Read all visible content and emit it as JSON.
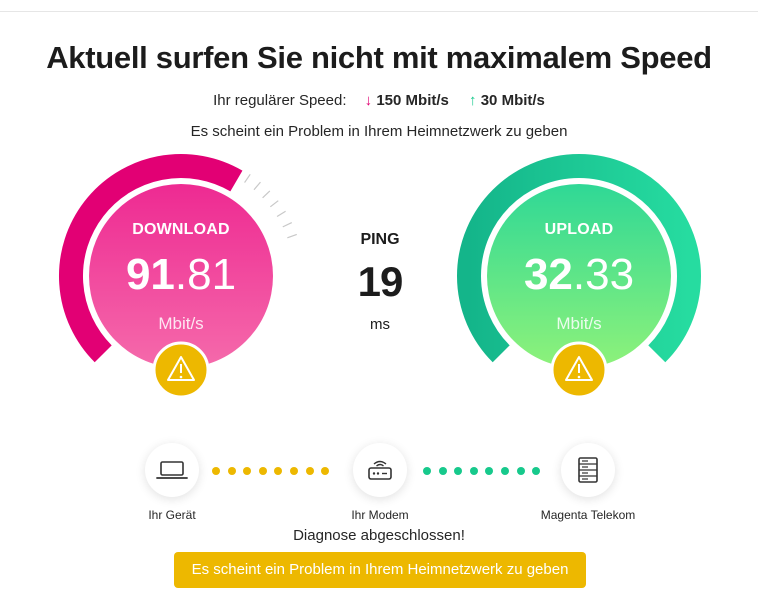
{
  "header": {
    "title": "Aktuell surfen Sie nicht mit maximalem Speed",
    "regular_speed_label": "Ihr regulärer Speed:",
    "download_speed": "150 Mbit/s",
    "upload_speed": "30 Mbit/s",
    "down_arrow": "↓",
    "up_arrow": "↑",
    "subtitle": "Es scheint ein Problem in Ihrem Heimnetzwerk zu geben"
  },
  "download": {
    "label": "DOWNLOAD",
    "value_int": "91",
    "value_dec": ".81",
    "unit": "Mbit/s",
    "color": "#e20074",
    "fraction_of_regular": 0.612,
    "warning_icon": "warning-icon"
  },
  "upload": {
    "label": "UPLOAD",
    "value_int": "32",
    "value_dec": ".33",
    "unit": "Mbit/s",
    "color": "#17c98c",
    "fraction_of_regular": 1.0,
    "warning_icon": "warning-icon"
  },
  "ping": {
    "label": "PING",
    "value": "19",
    "unit": "ms"
  },
  "diagnosis": {
    "nodes": [
      {
        "label": "Ihr Gerät",
        "icon": "laptop-icon"
      },
      {
        "label": "Ihr Modem",
        "icon": "router-icon"
      },
      {
        "label": "Magenta Telekom",
        "icon": "server-icon"
      }
    ],
    "left_link_color": "#edb800",
    "right_link_color": "#17c98c",
    "status": "Diagnose abgeschlossen!",
    "banner": "Es scheint ein Problem in Ihrem Heimnetzwerk zu geben",
    "banner_color": "#edb800"
  }
}
